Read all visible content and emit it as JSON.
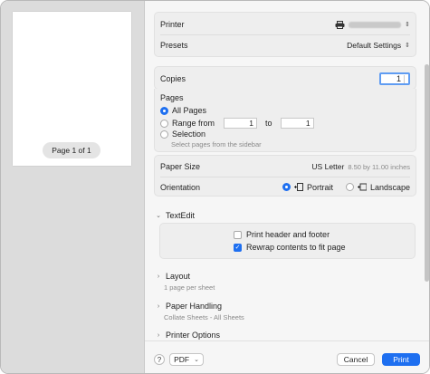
{
  "preview": {
    "page_indicator": "Page 1 of 1"
  },
  "printer": {
    "label": "Printer"
  },
  "presets": {
    "label": "Presets",
    "value": "Default Settings"
  },
  "copies": {
    "label": "Copies",
    "value": "1"
  },
  "pages": {
    "label": "Pages",
    "all_pages": "All Pages",
    "range_from": "Range from",
    "range_start": "1",
    "to": "to",
    "range_end": "1",
    "selection": "Selection",
    "selection_hint": "Select pages from the sidebar"
  },
  "paper_size": {
    "label": "Paper Size",
    "value": "US Letter",
    "detail": "8.50 by 11.00 inches"
  },
  "orientation": {
    "label": "Orientation",
    "portrait": "Portrait",
    "landscape": "Landscape"
  },
  "textedit": {
    "title": "TextEdit",
    "print_header_footer": "Print header and footer",
    "rewrap_contents": "Rewrap contents to fit page"
  },
  "layout": {
    "title": "Layout",
    "subtitle": "1 page per sheet"
  },
  "paper_handling": {
    "title": "Paper Handling",
    "subtitle": "Collate Sheets - All Sheets"
  },
  "printer_options": {
    "title": "Printer Options"
  },
  "footer": {
    "help": "?",
    "pdf": "PDF",
    "cancel": "Cancel",
    "print": "Print"
  },
  "colors": {
    "accent": "#1e6ff0"
  }
}
